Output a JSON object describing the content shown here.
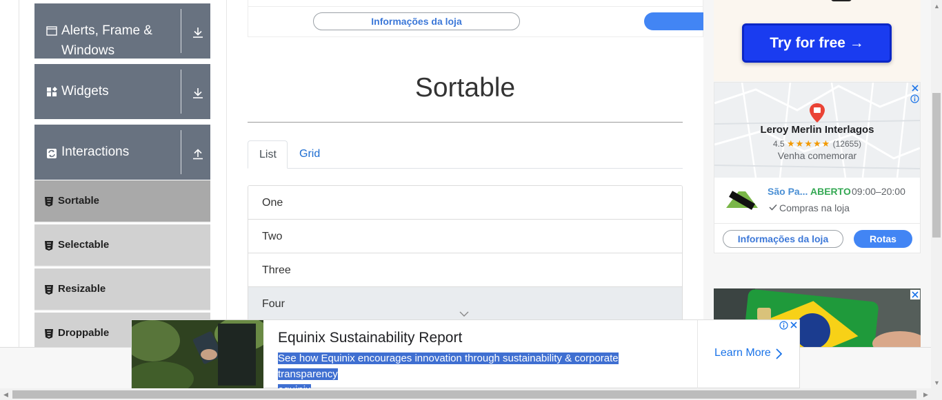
{
  "sidebar": {
    "groups": [
      {
        "label_line1": "Alerts, Frame &",
        "label_line2": "Windows",
        "icon": "window-icon",
        "arrow": "download-icon"
      },
      {
        "label": "Widgets",
        "icon": "widgets-icon",
        "arrow": "download-icon"
      },
      {
        "label": "Interactions",
        "icon": "interactions-icon",
        "arrow": "upload-icon"
      }
    ],
    "items": [
      {
        "label": "Sortable",
        "active": true
      },
      {
        "label": "Selectable",
        "active": false
      },
      {
        "label": "Resizable",
        "active": false
      },
      {
        "label": "Droppable",
        "active": false
      }
    ]
  },
  "main": {
    "top_store_button": "Informações da loja",
    "title": "Sortable",
    "tabs": [
      {
        "label": "List",
        "active": true
      },
      {
        "label": "Grid",
        "active": false
      }
    ],
    "list_items": [
      "One",
      "Two",
      "Three",
      "Four"
    ]
  },
  "ads": {
    "try_free": "Try for free →",
    "map": {
      "store_name": "Leroy Merlin Interlagos",
      "rating": "4.5",
      "stars": "★★★★★",
      "reviews": "(12655)",
      "tagline": "Venha comemorar",
      "city": "São Pa...",
      "status": "ABERTO",
      "hours": "09:00–20:00",
      "feature": "Compras na loja",
      "info_button": "Informações da loja",
      "route_button": "Rotas"
    },
    "bottom": {
      "title": "Equinix Sustainability Report",
      "desc_line1": "See how Equinix encourages innovation through sustainability & corporate transparency",
      "desc_line2": "equinix",
      "cta": "Learn More"
    }
  },
  "colors": {
    "nav_group_bg": "#687280",
    "nav_item_bg": "#d1d1d1",
    "nav_item_active_bg": "#a9a9a9",
    "link_blue": "#1c6cd1",
    "cta_blue": "#1a3cf0",
    "open_green": "#34a853"
  }
}
